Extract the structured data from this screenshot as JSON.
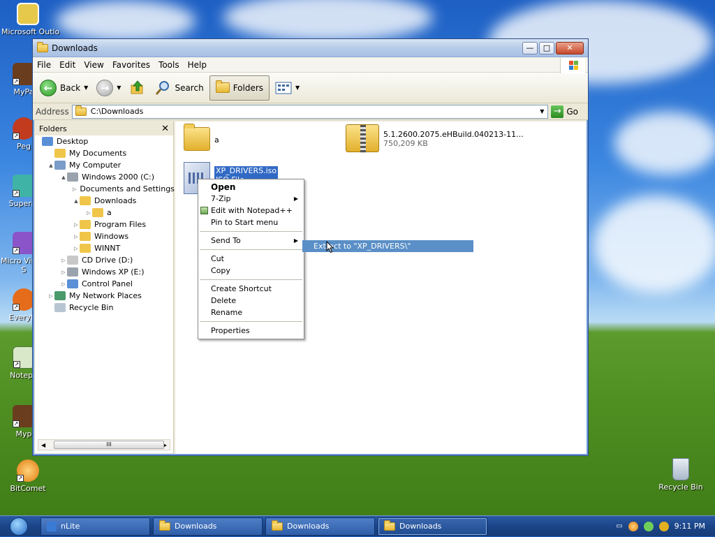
{
  "desktop": {
    "icons": [
      {
        "label": "Microsoft Outlo",
        "icon": "outlook-icon"
      },
      {
        "label": "MyPa",
        "icon": "mypaint-icon"
      },
      {
        "label": "Peg",
        "icon": "app-icon"
      },
      {
        "label": "Superm",
        "icon": "app-icon"
      },
      {
        "label": "Micro Visual S",
        "icon": "visual-studio-icon"
      },
      {
        "label": "Everyth",
        "icon": "everything-icon"
      },
      {
        "label": "Notepa",
        "icon": "notepad-icon"
      },
      {
        "label": "Myp",
        "icon": "app-icon"
      },
      {
        "label": "BitComet",
        "icon": "bitcomet-icon"
      },
      {
        "label": "Recycle Bin",
        "icon": "recycle-bin-icon"
      }
    ]
  },
  "window": {
    "title": "Downloads",
    "menu": [
      "File",
      "Edit",
      "View",
      "Favorites",
      "Tools",
      "Help"
    ],
    "toolbar": {
      "back": "Back",
      "search": "Search",
      "folders": "Folders"
    },
    "address": {
      "label": "Address",
      "value": "C:\\Downloads",
      "go": "Go"
    }
  },
  "folders_pane": {
    "header": "Folders",
    "tree": [
      {
        "label": "Desktop",
        "icon": "desktop-icon",
        "depth": 0,
        "exp": ""
      },
      {
        "label": "My Documents",
        "icon": "my-documents-icon",
        "depth": 1,
        "exp": ""
      },
      {
        "label": "My Computer",
        "icon": "my-computer-icon",
        "depth": 1,
        "exp": "▲"
      },
      {
        "label": "Windows 2000 (C:)",
        "icon": "drive-icon",
        "depth": 2,
        "exp": "▲"
      },
      {
        "label": "Documents and Settings",
        "icon": "folder-icon",
        "depth": 3,
        "exp": "▷"
      },
      {
        "label": "Downloads",
        "icon": "folder-icon",
        "depth": 3,
        "exp": "▲"
      },
      {
        "label": "a",
        "icon": "folder-icon",
        "depth": 4,
        "exp": "▷"
      },
      {
        "label": "Program Files",
        "icon": "folder-icon",
        "depth": 3,
        "exp": "▷"
      },
      {
        "label": "Windows",
        "icon": "folder-icon",
        "depth": 3,
        "exp": "▷"
      },
      {
        "label": "WINNT",
        "icon": "folder-icon",
        "depth": 3,
        "exp": "▷"
      },
      {
        "label": "CD Drive (D:)",
        "icon": "cd-drive-icon",
        "depth": 2,
        "exp": "▷"
      },
      {
        "label": "Windows XP (E:)",
        "icon": "drive-icon",
        "depth": 2,
        "exp": "▷"
      },
      {
        "label": "Control Panel",
        "icon": "control-panel-icon",
        "depth": 2,
        "exp": "▷"
      },
      {
        "label": "My Network Places",
        "icon": "network-icon",
        "depth": 1,
        "exp": "▷"
      },
      {
        "label": "Recycle Bin",
        "icon": "recycle-bin-icon",
        "depth": 1,
        "exp": ""
      }
    ],
    "scroll_thumb": "III"
  },
  "files": [
    {
      "name": "a",
      "icon": "folder-icon"
    },
    {
      "name": "5.1.2600.2075.eHBuild.040213-11...",
      "sub": "750,209 KB",
      "icon": "zip-icon"
    },
    {
      "name": "XP_DRIVERS.iso",
      "sub": "ISO File",
      "icon": "iso-icon",
      "selected": true
    }
  ],
  "context_menu": {
    "items": [
      "Open",
      "7-Zip",
      "Edit with Notepad++",
      "Pin to Start menu",
      "Send To",
      "Cut",
      "Copy",
      "Create Shortcut",
      "Delete",
      "Rename",
      "Properties"
    ],
    "submenu_item": "Extract to \"XP_DRIVERS\\\""
  },
  "taskbar": {
    "tasks": [
      "nLite",
      "Downloads",
      "Downloads",
      "Downloads"
    ],
    "clock": "9:11 PM"
  }
}
